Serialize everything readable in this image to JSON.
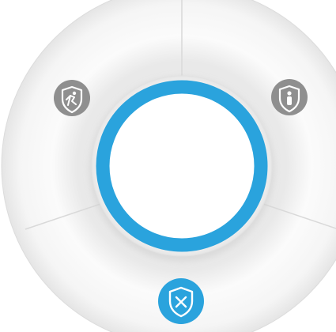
{
  "dial": {
    "accent_color": "#2aa3dd",
    "inactive_icon_color": "#8f8f8f",
    "ring_color": "#f3f3f3",
    "center_button_color": "#ffffff",
    "selected_mode": "disarm"
  },
  "modes": [
    {
      "id": "away",
      "icon": "shield-running-person-icon",
      "active": false
    },
    {
      "id": "stay",
      "icon": "shield-person-icon",
      "active": false
    },
    {
      "id": "disarm",
      "icon": "shield-x-icon",
      "active": true
    }
  ]
}
